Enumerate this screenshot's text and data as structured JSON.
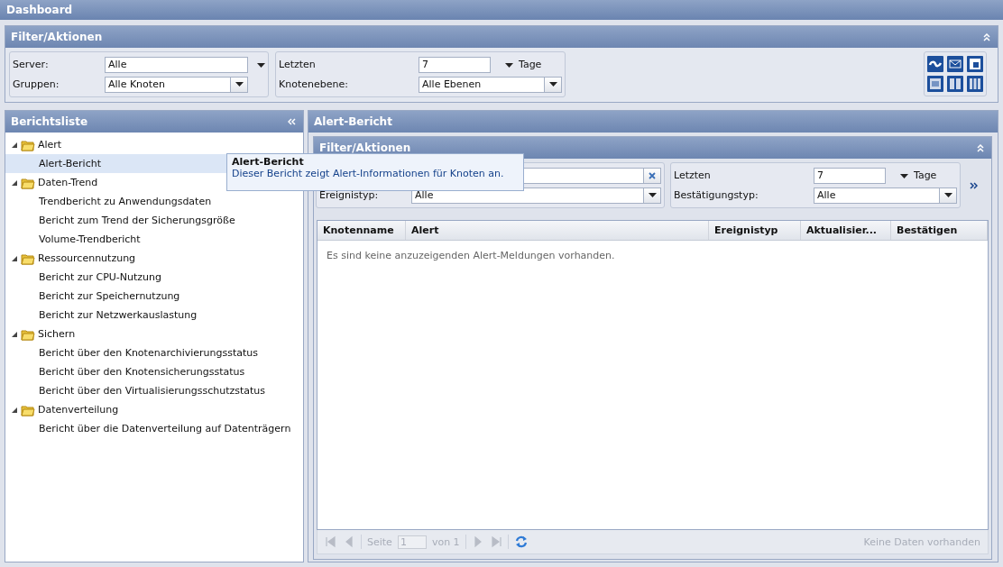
{
  "app_title": "Dashboard",
  "filter_panel": {
    "title": "Filter/Aktionen",
    "groups": [
      {
        "fields": [
          {
            "kind": "loose-select",
            "label": "Server:",
            "value": "Alle"
          },
          {
            "kind": "select",
            "label": "Gruppen:",
            "value": "Alle Knoten"
          }
        ]
      },
      {
        "fields": [
          {
            "kind": "number",
            "label": "Letzten",
            "value": "7",
            "unit": "Tage"
          },
          {
            "kind": "select",
            "label": "Knotenebene:",
            "value": "Alle Ebenen"
          }
        ]
      }
    ]
  },
  "report_list": {
    "title": "Berichtsliste",
    "tree": [
      {
        "label": "Alert",
        "expanded": true,
        "children": [
          {
            "label": "Alert-Bericht",
            "selected": true
          }
        ]
      },
      {
        "label": "Daten-Trend",
        "expanded": true,
        "children": [
          {
            "label": "Trendbericht zu Anwendungsdaten",
            "selected": false
          },
          {
            "label": "Bericht zum Trend der Sicherungsgröße",
            "selected": false
          },
          {
            "label": "Volume-Trendbericht",
            "selected": false
          }
        ]
      },
      {
        "label": "Ressourcennutzung",
        "expanded": true,
        "children": [
          {
            "label": "Bericht zur CPU-Nutzung",
            "selected": false
          },
          {
            "label": "Bericht zur Speichernutzung",
            "selected": false
          },
          {
            "label": "Bericht zur Netzwerkauslastung",
            "selected": false
          }
        ]
      },
      {
        "label": "Sichern",
        "expanded": true,
        "children": [
          {
            "label": "Bericht über den Knotenarchivierungsstatus",
            "selected": false
          },
          {
            "label": "Bericht über den Knotensicherungsstatus",
            "selected": false
          },
          {
            "label": "Bericht über den Virtualisierungsschutzstatus",
            "selected": false
          }
        ]
      },
      {
        "label": "Datenverteilung",
        "expanded": true,
        "children": [
          {
            "label": "Bericht über die Datenverteilung auf Datenträgern",
            "selected": false
          }
        ]
      }
    ]
  },
  "report_panel": {
    "title": "Alert-Bericht",
    "filter": {
      "title": "Filter/Aktionen",
      "groups": [
        {
          "fields": [
            {
              "kind": "clear"
            },
            {
              "kind": "select",
              "label": "Ereignistyp:",
              "value": "Alle"
            }
          ]
        },
        {
          "fields": [
            {
              "kind": "number",
              "label": "Letzten",
              "value": "7",
              "unit": "Tage"
            },
            {
              "kind": "select",
              "label": "Bestätigungstyp:",
              "value": "Alle"
            }
          ]
        }
      ]
    },
    "table": {
      "columns": [
        "Knotenname",
        "Alert",
        "Ereignistyp",
        "Aktualisier...",
        "Bestätigen"
      ],
      "empty_message": "Es sind keine anzuzeigenden Alert-Meldungen vorhanden."
    },
    "pager": {
      "disabled": true,
      "page_label": "Seite",
      "page_value": "1",
      "of_label": "von 1",
      "status": "Keine Daten vorhanden"
    }
  },
  "tooltip": {
    "title": "Alert-Bericht",
    "text": "Dieser Bericht zeigt Alert-Informationen für Knoten an."
  }
}
